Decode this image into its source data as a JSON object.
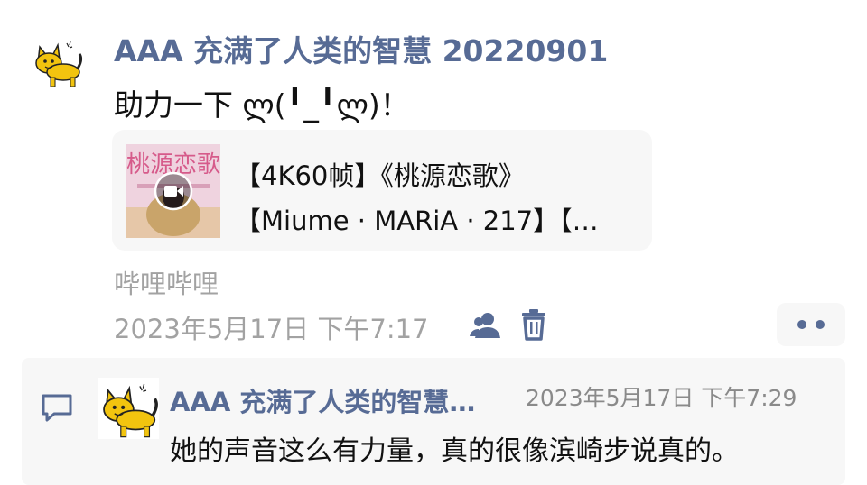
{
  "post": {
    "author": "AAA 充满了人类的智慧 20220901",
    "text": "助力一下 ლ(╹_╹ლ)！",
    "link": {
      "title_line1": "【4K60帧】《桃源恋歌》",
      "title_line2": "【Miume · MARiA · 217】【…",
      "thumbnail_text": "桃源恋歌"
    },
    "source": "哔哩哔哩",
    "time": "2023年5月17日 下午7:17",
    "icons": [
      "privacy-icon",
      "delete-icon",
      "more-icon"
    ]
  },
  "comment": {
    "author": "AAA 充满了人类的智慧…",
    "time": "2023年5月17日 下午7:29",
    "text": "她的声音这么有力量，真的很像滨崎步说真的。",
    "icon": "comment-icon"
  },
  "colors": {
    "accent": "#576b95",
    "meta": "#a2a2a2",
    "card_bg": "#f7f7f7"
  }
}
